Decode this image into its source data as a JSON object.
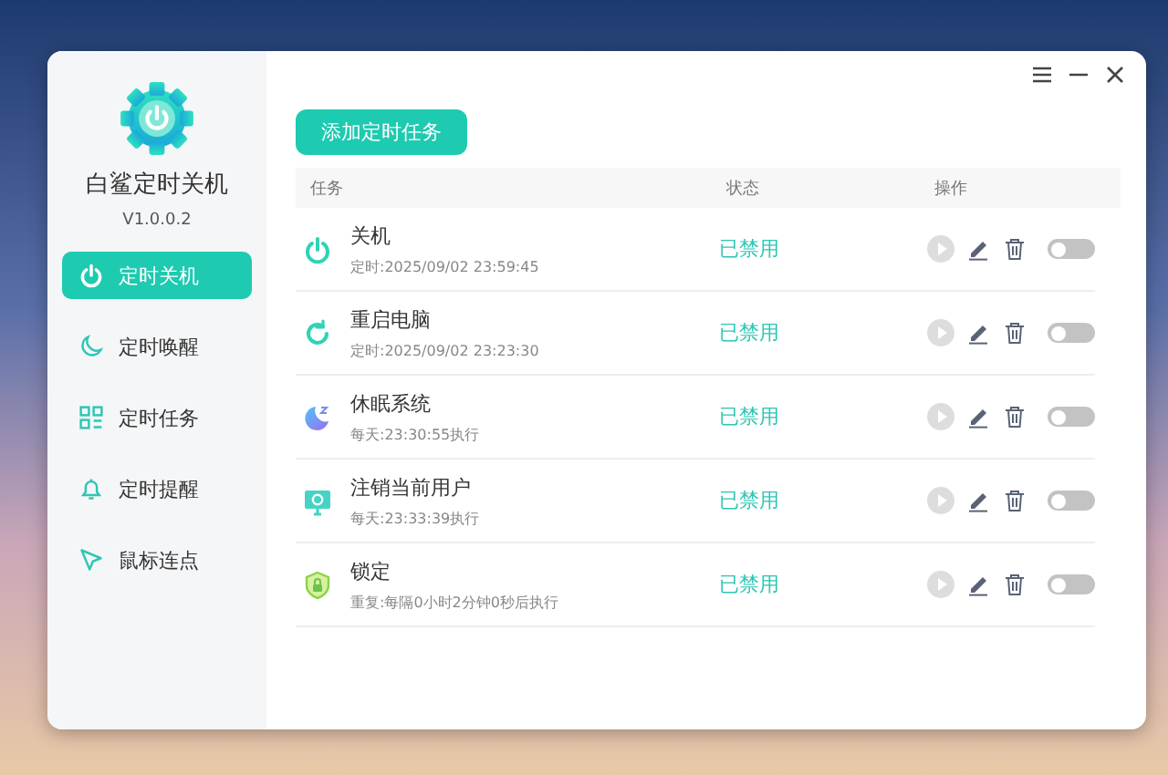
{
  "app": {
    "name": "白鲨定时关机",
    "version": "V1.0.0.2"
  },
  "nav": [
    {
      "label": "定时关机",
      "kind": "power",
      "selected": true
    },
    {
      "label": "定时唤醒",
      "kind": "moon",
      "selected": false
    },
    {
      "label": "定时任务",
      "kind": "grid",
      "selected": false
    },
    {
      "label": "定时提醒",
      "kind": "bell",
      "selected": false
    },
    {
      "label": "鼠标连点",
      "kind": "cursor",
      "selected": false
    }
  ],
  "add_button": "添加定时任务",
  "table": {
    "columns": [
      "任务",
      "状态",
      "操作"
    ],
    "rows": [
      {
        "kind": "power",
        "name": "关机",
        "schedule": "定时:2025/09/02 23:59:45",
        "status": "已禁用",
        "on": false
      },
      {
        "kind": "restart",
        "name": "重启电脑",
        "schedule": "定时:2025/09/02 23:23:30",
        "status": "已禁用",
        "on": false
      },
      {
        "kind": "sleep",
        "name": "休眠系统",
        "schedule": "每天:23:30:55执行",
        "status": "已禁用",
        "on": false
      },
      {
        "kind": "logout",
        "name": "注销当前用户",
        "schedule": "每天:23:33:39执行",
        "status": "已禁用",
        "on": false
      },
      {
        "kind": "lock",
        "name": "锁定",
        "schedule": "重复:每隔0小时2分钟0秒后执行",
        "status": "已禁用",
        "on": false
      }
    ]
  }
}
